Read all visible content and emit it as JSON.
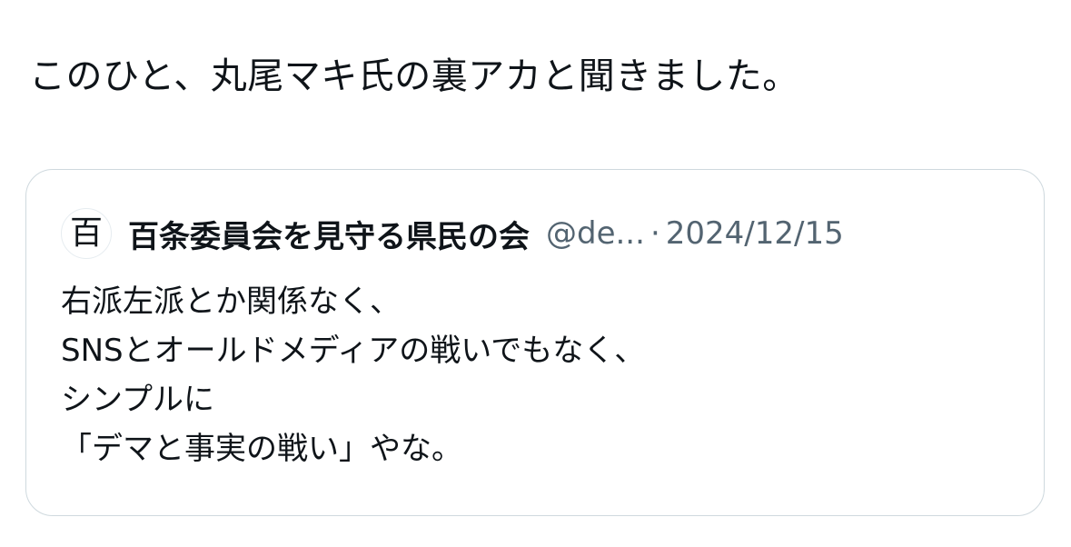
{
  "tweet": {
    "text": "このひと、丸尾マキ氏の裏アカと聞きました。"
  },
  "quoted_tweet": {
    "avatar_char": "百",
    "display_name": "百条委員会を見守る県民の会",
    "handle": "@de...",
    "separator": "·",
    "date": "2024/12/15",
    "lines": [
      "右派左派とか関係なく、",
      "SNSとオールドメディアの戦いでもなく、",
      "シンプルに",
      "「デマと事実の戦い」やな。"
    ]
  },
  "colors": {
    "text_primary": "#0f1419",
    "text_secondary": "#536471",
    "border": "#cfd9de"
  }
}
